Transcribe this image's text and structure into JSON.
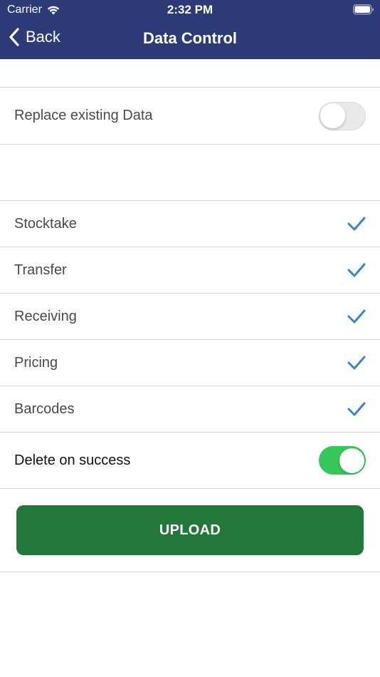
{
  "status_bar": {
    "carrier": "Carrier",
    "time": "2:32 PM"
  },
  "nav": {
    "back_label": "Back",
    "title": "Data Control"
  },
  "settings": {
    "replace_existing_data": {
      "label": "Replace existing Data",
      "on": false
    }
  },
  "data_types": [
    {
      "label": "Stocktake",
      "checked": true
    },
    {
      "label": "Transfer",
      "checked": true
    },
    {
      "label": "Receiving",
      "checked": true
    },
    {
      "label": "Pricing",
      "checked": true
    },
    {
      "label": "Barcodes",
      "checked": true
    }
  ],
  "delete_on_success": {
    "label": "Delete on success",
    "on": true
  },
  "upload": {
    "label": "UPLOAD"
  },
  "colors": {
    "header": "#2c3b78",
    "check": "#3a86c8",
    "toggle_on": "#34c759",
    "upload_button": "#227838"
  }
}
